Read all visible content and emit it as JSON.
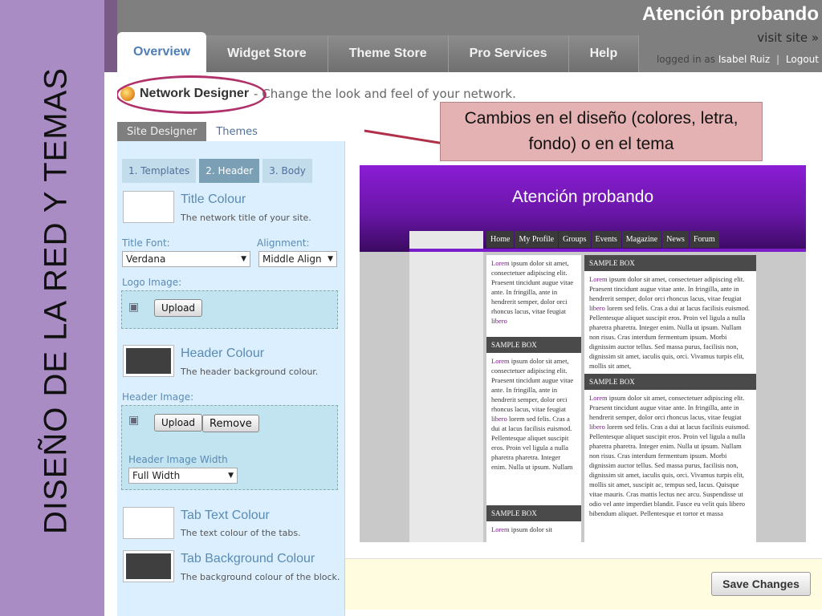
{
  "slide": {
    "vertical_title": "DISEÑO DE LA RED Y TEMAS",
    "callout_text": "Cambios en el diseño (colores, letra, fondo) o en el tema"
  },
  "app": {
    "site_title": "Atención probando",
    "visit_site": "visit site »",
    "logged_in_prefix": "logged in as",
    "user_name": "Isabel Ruiz",
    "separator": "|",
    "logout": "Logout"
  },
  "main_tabs": [
    {
      "label": "Overview",
      "active": true
    },
    {
      "label": "Widget Store",
      "active": false
    },
    {
      "label": "Theme Store",
      "active": false
    },
    {
      "label": "Pro Services",
      "active": false
    },
    {
      "label": "Help",
      "active": false
    }
  ],
  "network_designer": {
    "title": "Network Designer",
    "description": "- Change the look and feel of your network."
  },
  "sub_tabs": [
    {
      "label": "Site Designer",
      "active": false
    },
    {
      "label": "Themes",
      "active": true
    }
  ],
  "panel_tabs": [
    {
      "label": "1. Templates",
      "active": false
    },
    {
      "label": "2. Header",
      "active": true
    },
    {
      "label": "3. Body",
      "active": false
    }
  ],
  "options": {
    "title_colour": {
      "title": "Title Colour",
      "desc": "The network title of your site.",
      "swatch": "#ffffff"
    },
    "title_font": {
      "label": "Title Font:",
      "value": "Verdana"
    },
    "alignment": {
      "label": "Alignment:",
      "value": "Middle Align"
    },
    "logo_image": {
      "label": "Logo Image:",
      "upload": "Upload"
    },
    "header_colour": {
      "title": "Header Colour",
      "desc": "The header background colour.",
      "swatch": "#3f3f3f"
    },
    "header_image": {
      "label": "Header Image:",
      "upload": "Upload",
      "remove": "Remove"
    },
    "header_image_width": {
      "label": "Header Image Width",
      "value": "Full Width"
    },
    "tab_text_colour": {
      "title": "Tab Text Colour",
      "desc": "The text colour of the tabs.",
      "swatch": "#ffffff"
    },
    "tab_bg_colour": {
      "title": "Tab Background Colour",
      "desc": "The background colour of the block.",
      "swatch": "#3f3f3f"
    }
  },
  "preview": {
    "site_title": "Atención probando",
    "nav": [
      "Home",
      "My Profile",
      "Groups",
      "Events",
      "Magazine",
      "News",
      "Forum"
    ],
    "sample_box": "SAMPLE BOX",
    "left_col": [
      {
        "link": "Lorem",
        "text": " ipsum dolor sit amet, consectetuer adipiscing elit. Praesent tincidunt augue vitae ante. In fringilla, ante in hendrerit semper, dolor orci rhoncus lacus, vitae feugiat ",
        "link2": "libero",
        "text2": ""
      },
      {
        "link": "Lorem",
        "text": " ipsum dolor sit amet, consectetuer adipiscing elit. Praesent tincidunt augue vitae ante. In fringilla, ante in hendrerit semper, dolor orci rhoncus lacus, vitae feugiat ",
        "link2": "libero",
        "text2": " lorem sed felis. Cras a dui at lacus facilisis euismod. Pellentesque aliquet suscipit eros. Proin vel ligula a nulla pharetra pharetra. Integer enim. Nulla ut ipsum. Nullam"
      },
      {
        "link": "Lorem",
        "text": " ipsum dolor sit",
        "link2": "",
        "text2": ""
      }
    ],
    "right_col": [
      {
        "link": "Lorem",
        "text": " ipsum dolor sit amet, consectetuer adipiscing elit. Praesent tincidunt augue vitae ante. In fringilla, ante in hendrerit semper, dolor orci rhoncus lacus, vitae feugiat ",
        "link2": "libero",
        "text2": " lorem sed felis. Cras a dui at lacus facilisis euismod. Pellentesque aliquet suscipit eros. Proin vel ligula a nulla pharetra pharetra. Integer enim. Nulla ut ipsum. Nullam non risus. Cras interdum fermentum ipsum. Morbi dignissim auctor tellus. Sed massa purus, facilisis non, dignissim sit amet, iaculis quis, orci. Vivamus turpis elit, mollis sit amet,"
      },
      {
        "link": "Lorem",
        "text": " ipsum dolor sit amet, consectetuer adipiscing elit. Praesent tincidunt augue vitae ante. In fringilla, ante in hendrerit semper, dolor orci rhoncus lacus, vitae feugiat ",
        "link2": "libero",
        "text2": " lorem sed felis. Cras a dui at lacus facilisis euismod. Pellentesque aliquet suscipit eros. Proin vel ligula a nulla pharetra pharetra. Integer enim. Nulla ut ipsum. Nullam non risus. Cras interdum fermentum ipsum. Morbi dignissim auctor tellus. Sed massa purus, facilisis non, dignissim sit amet, iaculis quis, orci. Vivamus turpis elit, mollis sit amet, suscipit ac, tempus sed, lacus. Quisque vitae mauris. Cras mattis lectus nec arcu. Suspendisse ut odio vel ante imperdiet blandit. Fusce eu velit quis libero bibendum aliquet. Pellentesque et tortor et massa"
      }
    ]
  },
  "save_changes": "Save Changes",
  "colors": {
    "slide_band": "#a98cc4",
    "topbar": "#7f7f7f",
    "accent_blue": "#4f7fb4",
    "oval": "#b0306a",
    "callout_bg": "#e4b2b2",
    "arrow": "#b0304a",
    "preview_header": "#8a1dd4"
  }
}
